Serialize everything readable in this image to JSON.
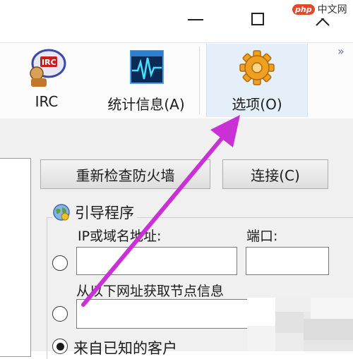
{
  "window": {
    "minimize_icon": "minimize-icon",
    "maximize_icon": "maximize-icon",
    "close_icon": "close-icon"
  },
  "watermark": {
    "badge": "php",
    "text": "中文网"
  },
  "toolbar": {
    "items": [
      {
        "label": "IRC",
        "icon": "irc-chat-icon"
      },
      {
        "label": "统计信息(A)",
        "icon": "statistics-waveform-icon"
      },
      {
        "label": "选项(O)",
        "icon": "gear-icon",
        "selected": true
      }
    ],
    "overflow": "»"
  },
  "main": {
    "recheck_firewall_button": "重新检查防火墙",
    "connect_button": "连接(C)",
    "bootstrap_group": {
      "title": "引导程序",
      "ip_label": "IP或域名地址:",
      "port_label": "端口:",
      "ip_value": "",
      "port_value": "",
      "url_label": "从以下网址获取节点信息",
      "url_value": "",
      "known_clients_label": "来自已知的客户"
    }
  },
  "colors": {
    "arrow": "#c930d6",
    "selected_tab": "#e4eff9",
    "panel": "#f0f0f0"
  }
}
